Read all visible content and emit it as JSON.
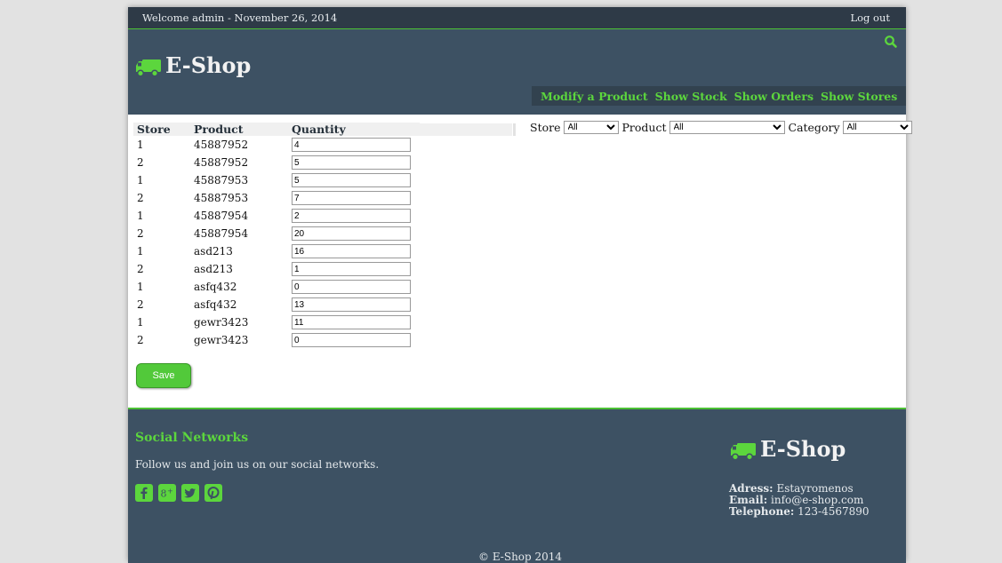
{
  "topbar": {
    "welcome": "Welcome admin -  November 26, 2014",
    "logout": "Log out"
  },
  "brand": {
    "name": "E-Shop"
  },
  "nav": [
    "Modify a Product",
    "Show Stock",
    "Show Orders",
    "Show Stores"
  ],
  "table": {
    "headers": [
      "Store",
      "Product",
      "Quantity"
    ],
    "rows": [
      {
        "store": "1",
        "product": "45887952",
        "quantity": "4"
      },
      {
        "store": "2",
        "product": "45887952",
        "quantity": "5"
      },
      {
        "store": "1",
        "product": "45887953",
        "quantity": "5"
      },
      {
        "store": "2",
        "product": "45887953",
        "quantity": "7"
      },
      {
        "store": "1",
        "product": "45887954",
        "quantity": "2"
      },
      {
        "store": "2",
        "product": "45887954",
        "quantity": "20"
      },
      {
        "store": "1",
        "product": "asd213",
        "quantity": "16"
      },
      {
        "store": "2",
        "product": "asd213",
        "quantity": "1"
      },
      {
        "store": "1",
        "product": "asfq432",
        "quantity": "0"
      },
      {
        "store": "2",
        "product": "asfq432",
        "quantity": "13"
      },
      {
        "store": "1",
        "product": "gewr3423",
        "quantity": "11"
      },
      {
        "store": "2",
        "product": "gewr3423",
        "quantity": "0"
      }
    ]
  },
  "filters": {
    "store_label": "Store",
    "store_value": "All",
    "product_label": "Product",
    "product_value": "All",
    "category_label": "Category",
    "category_value": "All"
  },
  "save_label": "Save",
  "footer": {
    "social_title": "Social Networks",
    "social_text": "Follow us and join us on our social networks.",
    "social_icons": [
      "facebook-icon",
      "google-plus-icon",
      "twitter-icon",
      "pinterest-icon"
    ],
    "address_label": "Adress:",
    "address_value": "Estayromenos",
    "email_label": "Email:",
    "email_value": "info@e-shop.com",
    "phone_label": "Telephone:",
    "phone_value": "123-4567890",
    "copyright": "© E-Shop 2014"
  },
  "colors": {
    "accent": "#4cc134",
    "header_bg": "#3d5163",
    "topbar_bg": "#2e3a47"
  }
}
